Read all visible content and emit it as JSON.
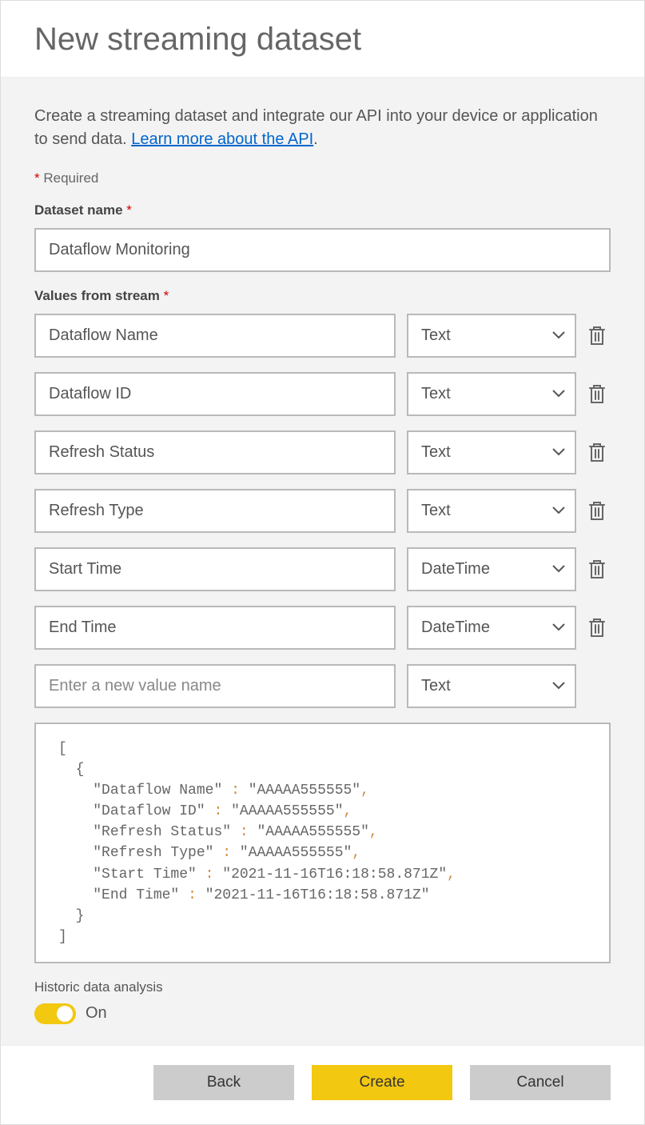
{
  "title": "New streaming dataset",
  "description": {
    "text_before": "Create a streaming dataset and integrate our API into your device or application to send data. ",
    "link_text": "Learn more about the API",
    "text_after": "."
  },
  "required_label": "Required",
  "dataset_name": {
    "label": "Dataset name",
    "value": "Dataflow Monitoring"
  },
  "values_from_stream_label": "Values from stream",
  "stream_values": [
    {
      "name": "Dataflow Name",
      "type": "Text",
      "deletable": true
    },
    {
      "name": "Dataflow ID",
      "type": "Text",
      "deletable": true
    },
    {
      "name": "Refresh Status",
      "type": "Text",
      "deletable": true
    },
    {
      "name": "Refresh Type",
      "type": "Text",
      "deletable": true
    },
    {
      "name": "Start Time",
      "type": "DateTime",
      "deletable": true
    },
    {
      "name": "End Time",
      "type": "DateTime",
      "deletable": true
    }
  ],
  "new_value_row": {
    "placeholder": "Enter a new value name",
    "type": "Text"
  },
  "json_preview": {
    "lines": [
      {
        "indent": 0,
        "text": "["
      },
      {
        "indent": 1,
        "text": "{"
      },
      {
        "indent": 2,
        "key": "Dataflow Name",
        "value": "AAAAA555555",
        "comma": true
      },
      {
        "indent": 2,
        "key": "Dataflow ID",
        "value": "AAAAA555555",
        "comma": true
      },
      {
        "indent": 2,
        "key": "Refresh Status",
        "value": "AAAAA555555",
        "comma": true
      },
      {
        "indent": 2,
        "key": "Refresh Type",
        "value": "AAAAA555555",
        "comma": true
      },
      {
        "indent": 2,
        "key": "Start Time",
        "value": "2021-11-16T16:18:58.871Z",
        "comma": true
      },
      {
        "indent": 2,
        "key": "End Time",
        "value": "2021-11-16T16:18:58.871Z",
        "comma": false
      },
      {
        "indent": 1,
        "text": "}"
      },
      {
        "indent": 0,
        "text": "]"
      }
    ]
  },
  "historic": {
    "label": "Historic data analysis",
    "state_text": "On",
    "on": true
  },
  "buttons": {
    "back": "Back",
    "create": "Create",
    "cancel": "Cancel"
  }
}
